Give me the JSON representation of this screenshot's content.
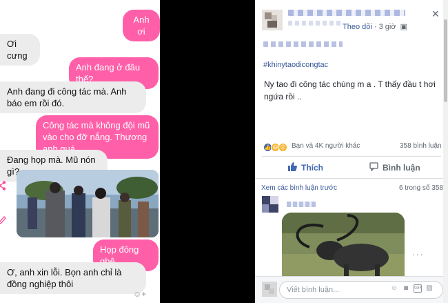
{
  "chat": {
    "messages": [
      {
        "side": "out",
        "text": "Anh ơi"
      },
      {
        "side": "in",
        "text": "Ơi cưng"
      },
      {
        "side": "out",
        "text": "Anh đang ở đâu thế?"
      },
      {
        "side": "in",
        "text": "Anh đang đi công tác mà. Anh báo em rồi đó."
      },
      {
        "side": "out",
        "text": "Công tác mà không đội mũ vào cho đỡ nắng. Thương anh quá"
      },
      {
        "side": "in",
        "text": "Đang họp mà. Mũ nón gì?"
      },
      {
        "side": "out",
        "text": "Họp đông ghê"
      },
      {
        "side": "in",
        "text": "Ơ, anh xin lỗi. Bọn anh chỉ là đồng nghiệp thôi"
      }
    ],
    "icons": {
      "share": "share-icon",
      "edit": "pencil-icon",
      "emoji": "emoji-icon"
    }
  },
  "post": {
    "follow_label": "Theo dõi",
    "time": "3 giờ",
    "hashtag": "#khinytaodicongtac",
    "text": "Ny tao đi công tác chúng m a . T thấy đầu t hơi ngứa rồi ..",
    "reactions_text": "Bạn và 4K người khác",
    "comments_count": "358 bình luận",
    "like_label": "Thích",
    "comment_label": "Bình luận",
    "view_previous": "Xem các bình luận trước",
    "page_count": "6 trong số 358",
    "composer_placeholder": "Viết bình luận...",
    "composer_icons": [
      "emoji-icon",
      "camera-icon",
      "gif-icon",
      "sticker-icon"
    ]
  },
  "colors": {
    "outgoing_bubble": "#ff5fa8",
    "incoming_bubble": "#ececec",
    "fb_blue": "#4267b2",
    "link_blue": "#385898"
  }
}
